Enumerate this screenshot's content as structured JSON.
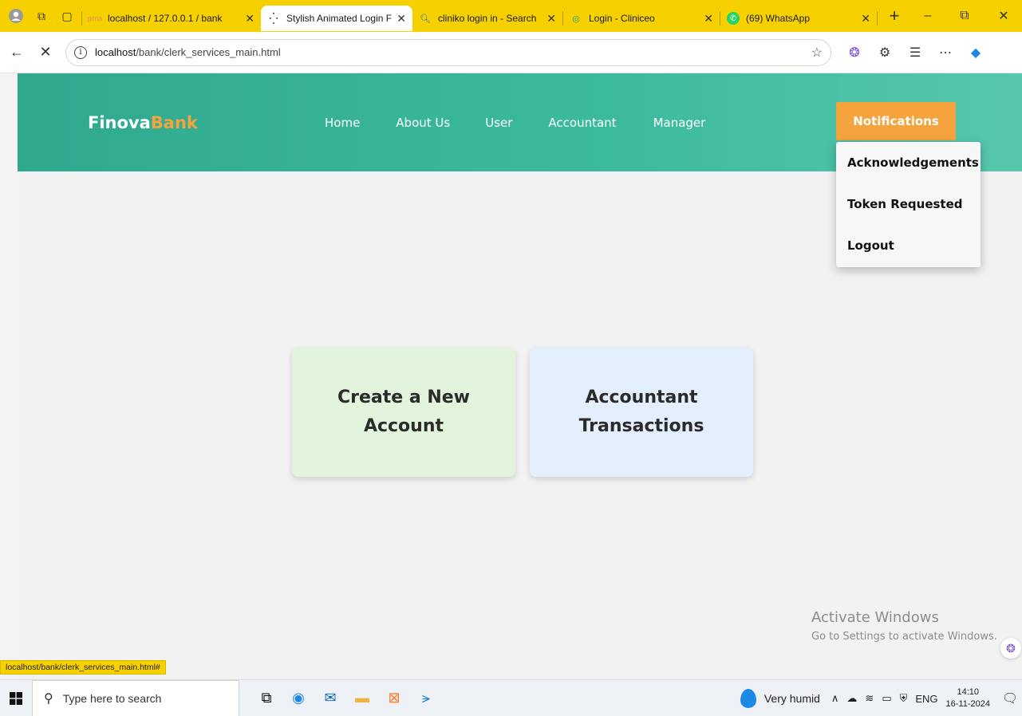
{
  "browser": {
    "tabs": [
      {
        "title": "localhost / 127.0.0.1 / bank",
        "favicon": "phpmyadmin-icon",
        "active": false
      },
      {
        "title": "Stylish Animated Login For",
        "favicon": "loading-icon",
        "active": true
      },
      {
        "title": "cliniko login in - Search",
        "favicon": "search-icon",
        "active": false
      },
      {
        "title": "Login - Cliniceo",
        "favicon": "cliniceo-icon",
        "active": false
      },
      {
        "title": "(69) WhatsApp",
        "favicon": "whatsapp-icon",
        "active": false
      }
    ],
    "address": {
      "host": "localhost",
      "path": "/bank/clerk_services_main.html"
    }
  },
  "site": {
    "brand_main": "Finova",
    "brand_accent": "Bank",
    "menu": [
      "Home",
      "About Us",
      "User",
      "Accountant",
      "Manager"
    ],
    "notifications_label": "Notifications",
    "dropdown": [
      "Acknowledgements",
      "Token Requested",
      "Logout"
    ],
    "cards": {
      "create": "Create a New Account",
      "transactions": "Accountant Transactions"
    },
    "colors": {
      "header_start": "#2fa98e",
      "header_end": "#56c7ad",
      "accent": "#f5a33d",
      "card_green": "#e2f5dc",
      "card_blue": "#e4effd"
    }
  },
  "watermark": {
    "line1": "Activate Windows",
    "line2": "Go to Settings to activate Windows."
  },
  "status_url": "localhost/bank/clerk_services_main.html#",
  "taskbar": {
    "search_placeholder": "Type here to search",
    "weather": "Very humid",
    "language": "ENG",
    "time": "14:10",
    "date": "16-11-2024"
  }
}
